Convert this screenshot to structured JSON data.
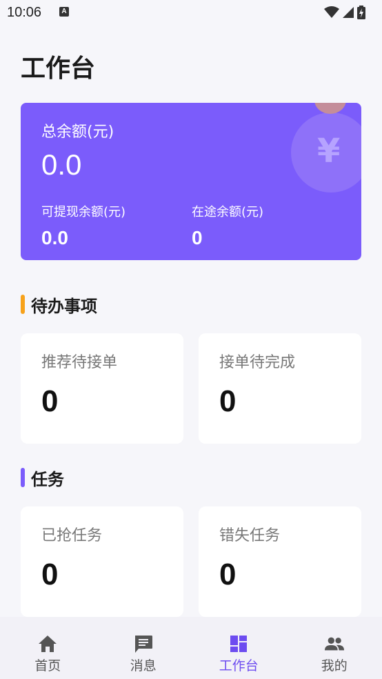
{
  "status_bar": {
    "time": "10:06",
    "notification_glyph": "A"
  },
  "page": {
    "title": "工作台"
  },
  "balance": {
    "total_label": "总余额(元)",
    "total_value": "0.0",
    "withdrawable_label": "可提现余额(元)",
    "withdrawable_value": "0.0",
    "in_transit_label": "在途余额(元)",
    "in_transit_value": "0",
    "currency_icon": "¥",
    "card_color": "#7b5cfb"
  },
  "todo": {
    "title": "待办事项",
    "accent_color": "#f7a21b",
    "cards": [
      {
        "label": "推荐待接单",
        "value": "0"
      },
      {
        "label": "接单待完成",
        "value": "0"
      }
    ]
  },
  "tasks": {
    "title": "任务",
    "accent_color": "#7b5cfb",
    "cards": [
      {
        "label": "已抢任务",
        "value": "0"
      },
      {
        "label": "错失任务",
        "value": "0"
      }
    ]
  },
  "nav": {
    "active_color": "#6d4cf0",
    "items": [
      {
        "label": "首页",
        "icon": "home-icon"
      },
      {
        "label": "消息",
        "icon": "message-icon"
      },
      {
        "label": "工作台",
        "icon": "dashboard-icon",
        "active": true
      },
      {
        "label": "我的",
        "icon": "people-icon"
      }
    ]
  }
}
